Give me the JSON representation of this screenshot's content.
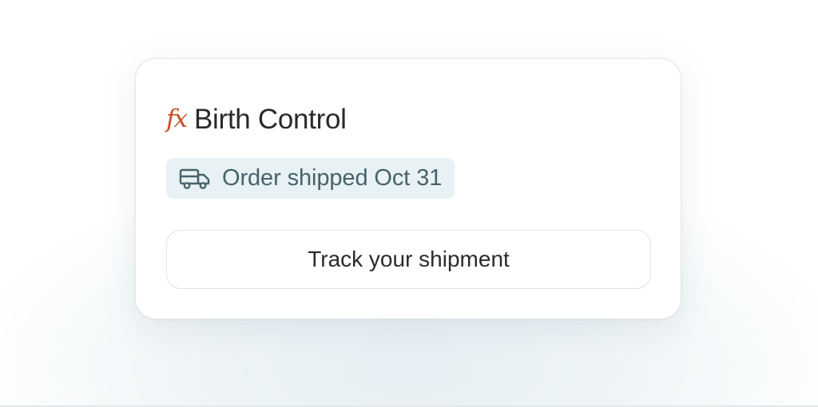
{
  "card": {
    "brand_icon": "fx-icon",
    "brand_glyph": "fx",
    "title": "Birth Control",
    "status": {
      "icon": "truck-icon",
      "text": "Order shipped Oct 31"
    },
    "track_button_label": "Track your shipment"
  },
  "colors": {
    "brand_accent": "#c64f22",
    "status_background": "#e8f1f4",
    "status_text": "#46636b",
    "title_text": "#2a2a2a"
  }
}
